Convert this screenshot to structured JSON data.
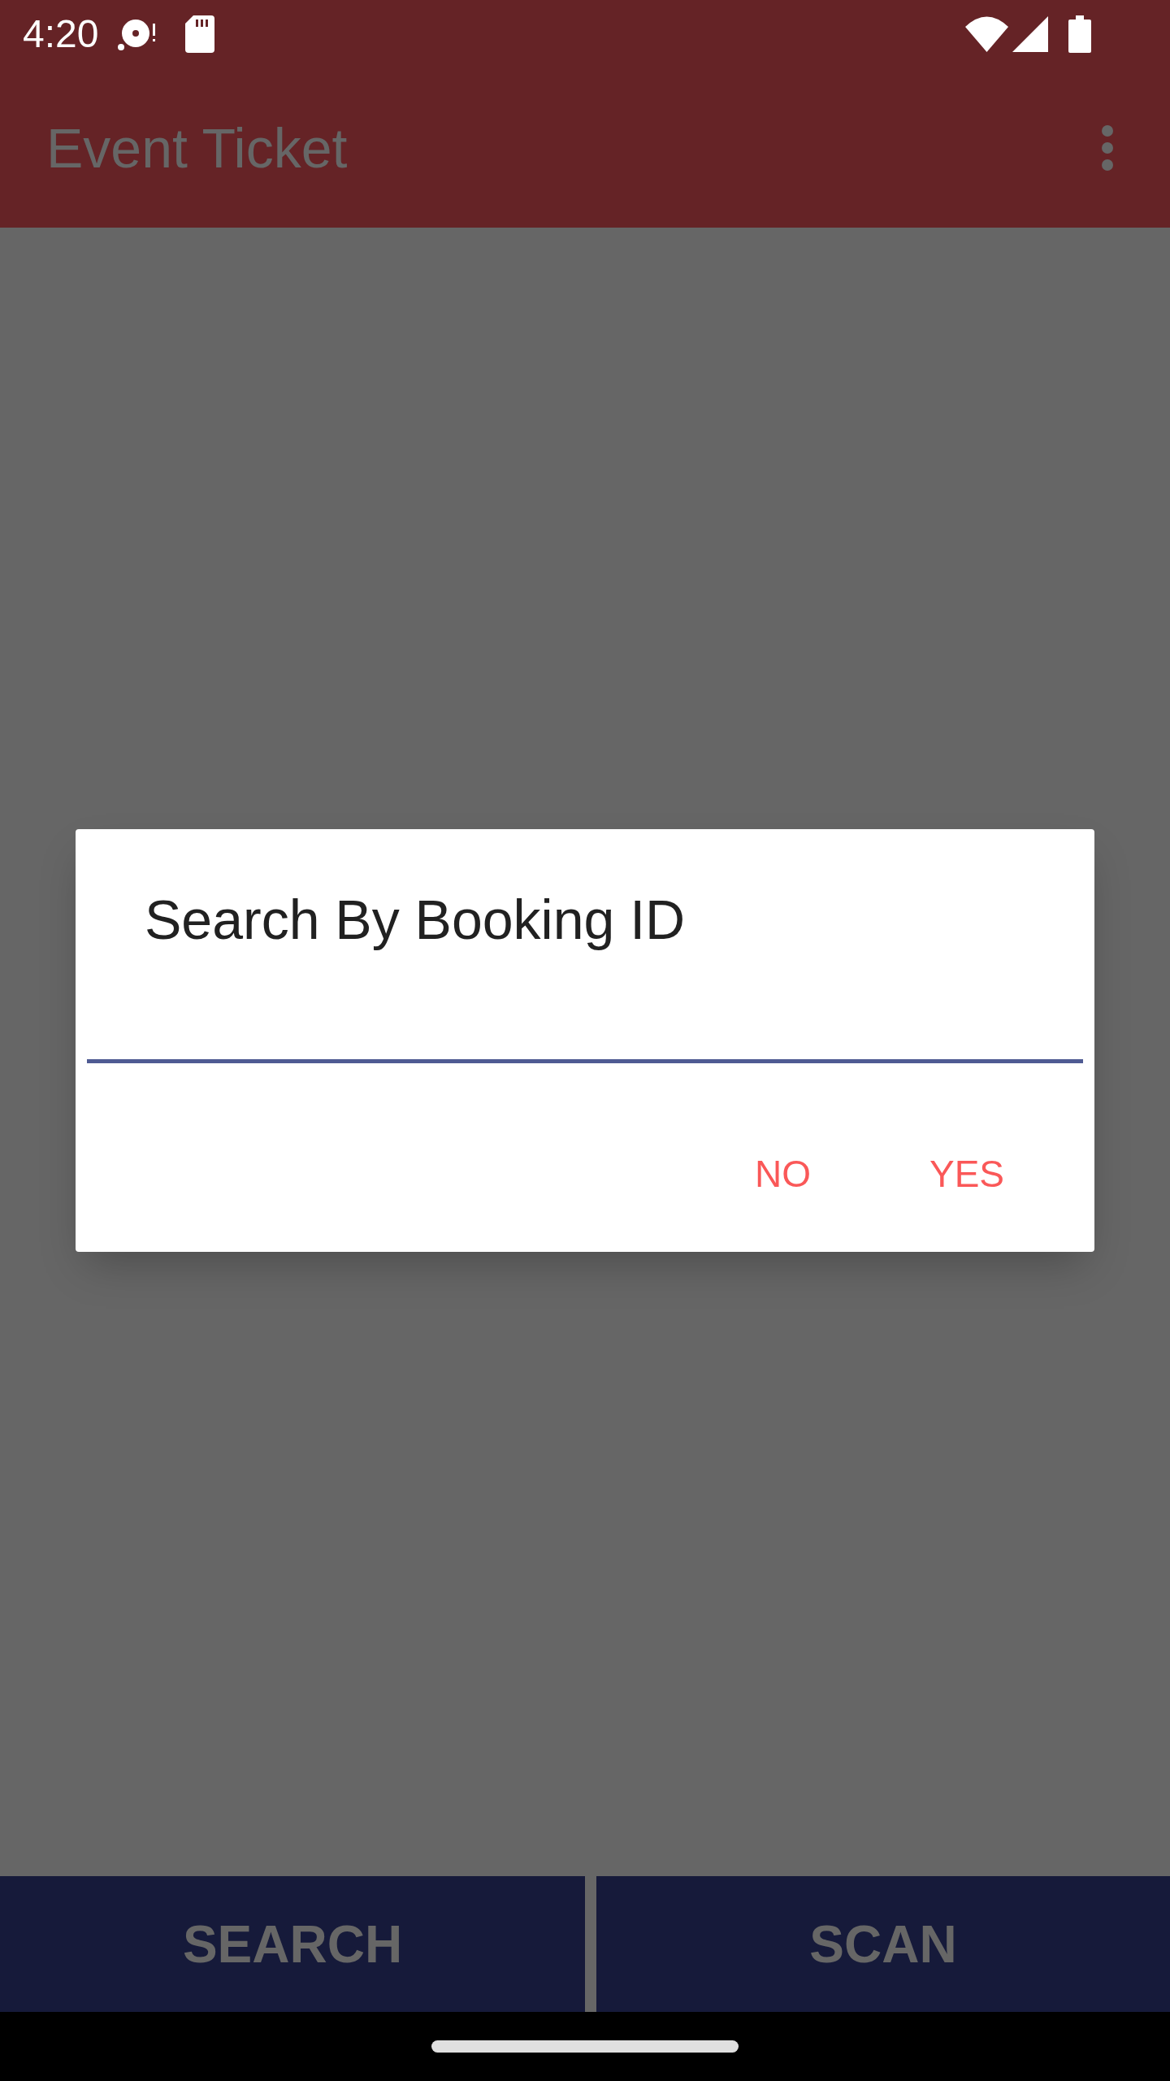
{
  "status_bar": {
    "time": "4:20"
  },
  "app_bar": {
    "title": "Event Ticket"
  },
  "dialog": {
    "title": "Search By Booking ID",
    "buttons": [
      {
        "label": "NO"
      },
      {
        "label": "YES"
      }
    ]
  },
  "bottom_bar": {
    "buttons": [
      {
        "label": "SEARCH"
      },
      {
        "label": "SCAN"
      }
    ]
  }
}
